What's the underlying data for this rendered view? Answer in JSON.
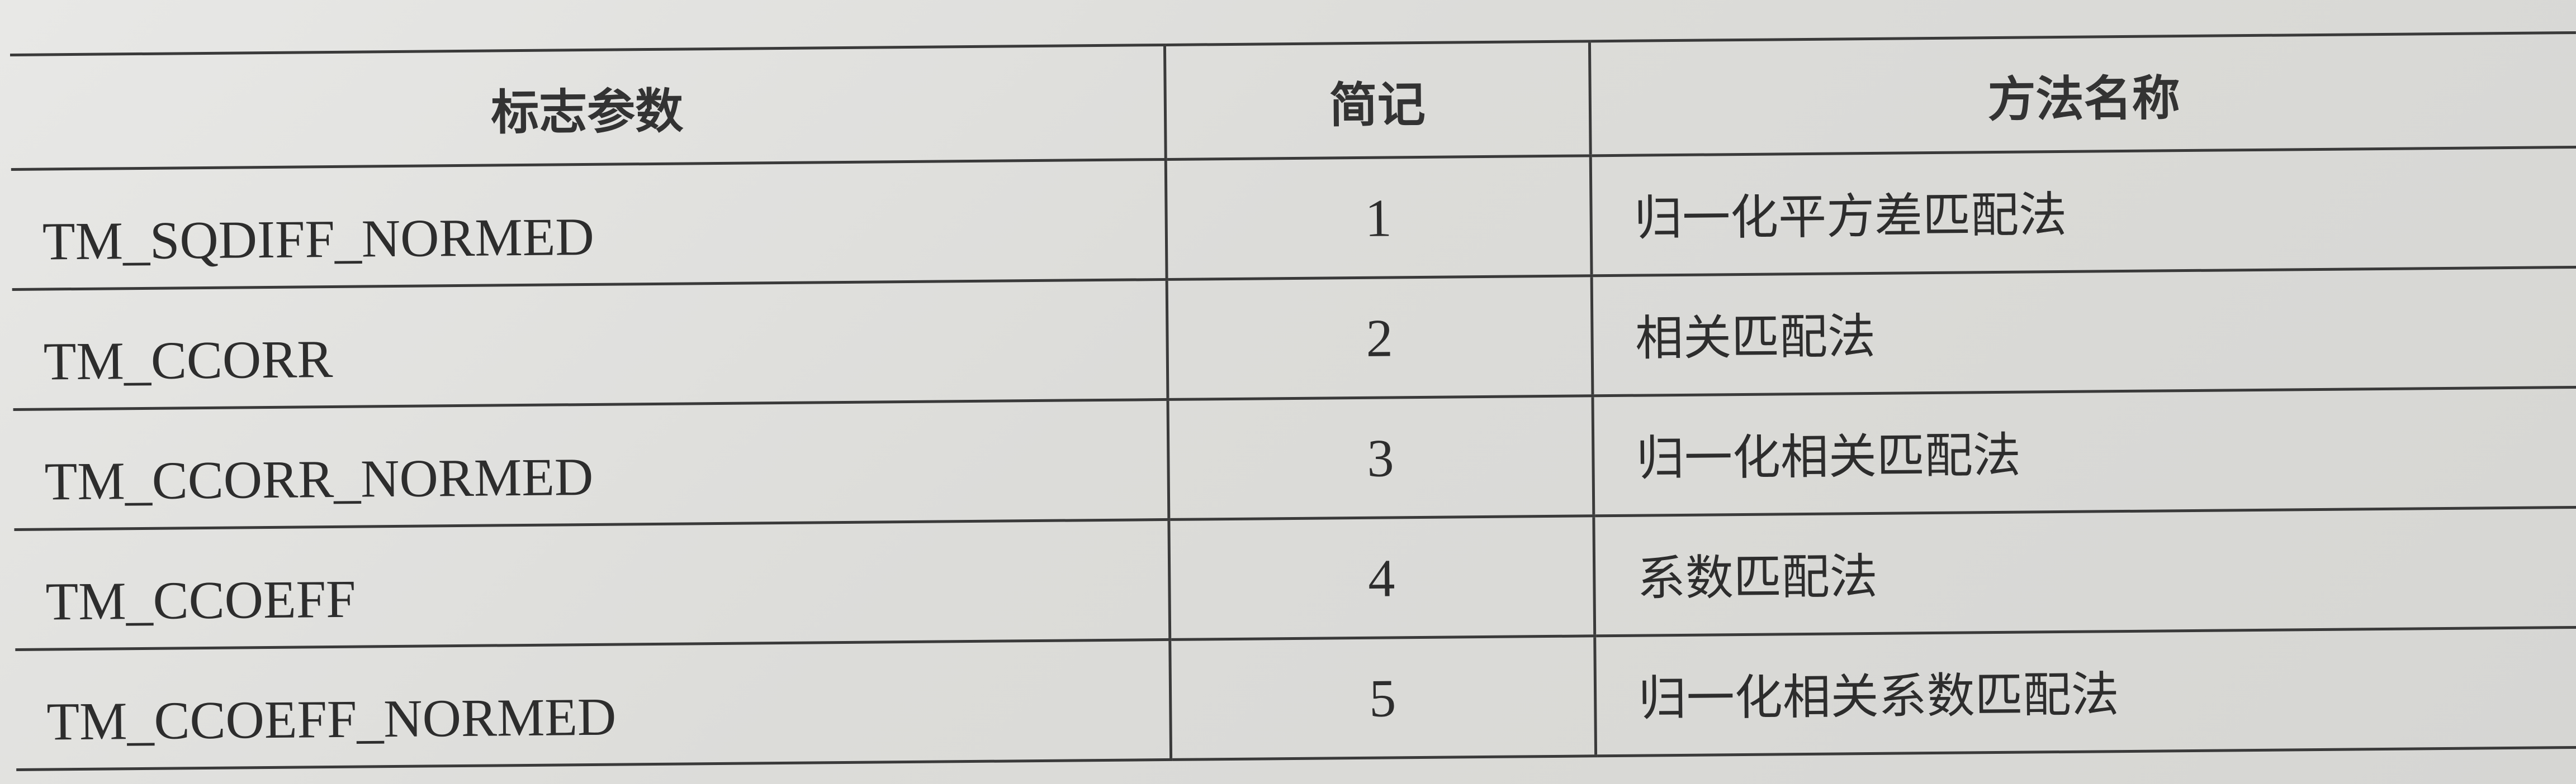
{
  "table": {
    "headers": {
      "flag": "标志参数",
      "abbr": "简记",
      "method": "方法名称"
    },
    "rows": [
      {
        "flag": "TM_SQDIFF_NORMED",
        "abbr": "1",
        "method": "归一化平方差匹配法"
      },
      {
        "flag": "TM_CCORR",
        "abbr": "2",
        "method": "相关匹配法"
      },
      {
        "flag": "TM_CCORR_NORMED",
        "abbr": "3",
        "method": "归一化相关匹配法"
      },
      {
        "flag": "TM_CCOEFF",
        "abbr": "4",
        "method": "系数匹配法"
      },
      {
        "flag": "TM_CCOEFF_NORMED",
        "abbr": "5",
        "method": "归一化相关系数匹配法"
      }
    ]
  }
}
